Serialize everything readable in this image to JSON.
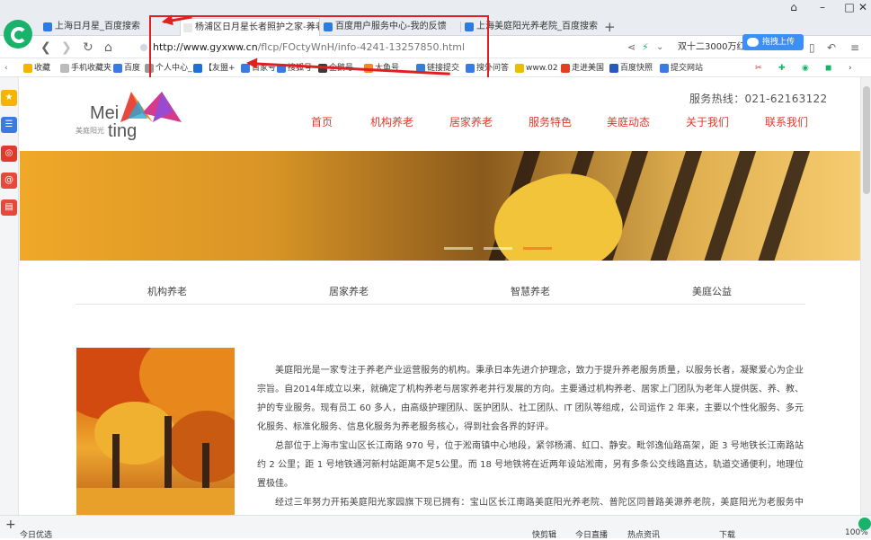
{
  "browser": {
    "tabs": [
      {
        "label": "上海日月星_百度搜索"
      },
      {
        "label": "杨浦区日月星长者照护之家-养老",
        "active": true
      },
      {
        "label": "百度用户服务中心-我的反馈"
      },
      {
        "label": "上海美庭阳光养老院_百度搜索"
      }
    ],
    "new_tab": "+",
    "url_domain": "http://www.gyxww.cn",
    "url_path": "/flcp/FOctyWnH/info-4241-13257850.html",
    "search_text": "双十二3000万红包等你拿",
    "drag_upload": "拖拽上传",
    "window_controls": {
      "minimize": "–",
      "maximize": "□",
      "close": "✕"
    },
    "bookmarks": [
      "收藏",
      "手机收藏夹",
      "百度",
      "个人中心_",
      "【友盟+",
      "百家号",
      "搜狐号",
      "企鹅号",
      "大鱼号",
      "链接提交",
      "搜外问答",
      "www.02",
      "走进美国",
      "百度快照",
      "提交网站"
    ],
    "status_left": "今日优选",
    "status_right": [
      "快剪辑",
      "今日直播",
      "热点资讯",
      "下载",
      "100%"
    ]
  },
  "site": {
    "hotline": "服务热线：021-62163122",
    "logo_text_1": "Mei",
    "logo_text_2": "ting",
    "logo_cn": "美庭阳光",
    "nav": [
      "首页",
      "机构养老",
      "居家养老",
      "服务特色",
      "美庭动态",
      "关于我们",
      "联系我们"
    ],
    "subnav": [
      "机构养老",
      "居家养老",
      "智慧养老",
      "美庭公益"
    ],
    "paragraphs": [
      "美庭阳光是一家专注于养老产业运营服务的机构。秉承日本先进介护理念，致力于提升养老服务质量，以服务长者，凝聚爱心为企业宗旨。自2014年成立以来，就确定了机构养老与居家养老并行发展的方向。主要通过机构养老、居家上门团队为老年人提供医、养、教、护的专业服务。现有员工 60 多人，由高级护理团队、医护团队、社工团队、IT 团队等组成，公司运作 2 年来，主要以个性化服务、多元化服务、标准化服务、信息化服务为养老服务核心，得到社会各界的好评。",
      "总部位于上海市宝山区长江南路 970 号，位于淞南镇中心地段，紧邻杨浦、虹口、静安。毗邻逸仙路高架，距 3 号地铁长江南路站约 2 公里；距 1 号地铁通河新村站距离不足5公里。而 18 号地铁将在近两年设站淞南，另有多条公交线路直达，轨道交通便利，地理位置极佳。",
      "经过三年努力开拓美庭阳光家园旗下现已拥有：宝山区长江南路美庭阳光养老院、普陀区同普路美源养老院，美庭阳光为老服务中心。美庭阳光致力于搭建机构、社区、居家养老生态体系，提供完善的养老护理服务，以机构为依托，以社区服务覆盖为核心，输出服务与文化。"
    ]
  }
}
